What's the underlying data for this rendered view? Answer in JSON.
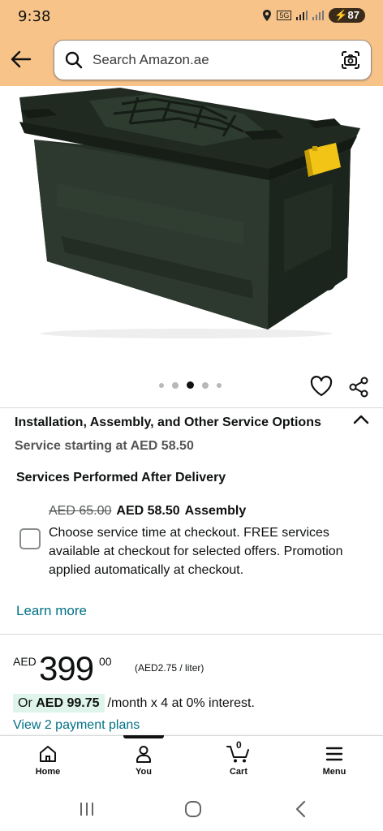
{
  "status_bar": {
    "time": "9:38",
    "network": "5G",
    "battery": "87"
  },
  "search": {
    "placeholder": "Search Amazon.ae"
  },
  "carousel": {
    "total": 5,
    "active_index": 2
  },
  "services": {
    "title": "Installation, Assembly, and Other Service Options",
    "starting": "Service starting at AED 58.50",
    "after_delivery": "Services Performed After Delivery",
    "option": {
      "original_price": "AED 65.00",
      "price": "AED 58.50",
      "type": "Assembly",
      "description": "Choose service time at checkout. FREE services available at checkout for selected offers. Promotion applied automatically at checkout.",
      "checked": false
    },
    "learn_more": "Learn more"
  },
  "price": {
    "currency": "AED",
    "whole": "399",
    "fraction": "00",
    "unit_price": "(AED2.75 / liter)"
  },
  "installment": {
    "prefix": "Or",
    "amount": "AED 99.75",
    "suffix": "/month x 4 at 0% interest."
  },
  "payment_plans_link": "View 2 payment plans",
  "bottom_nav": {
    "home": "Home",
    "you": "You",
    "cart": "Cart",
    "cart_count": "0",
    "menu": "Menu"
  },
  "colors": {
    "header": "#f7c389",
    "link": "#007185",
    "installment_highlight": "#dff5ec",
    "latch": "#f2c416"
  }
}
